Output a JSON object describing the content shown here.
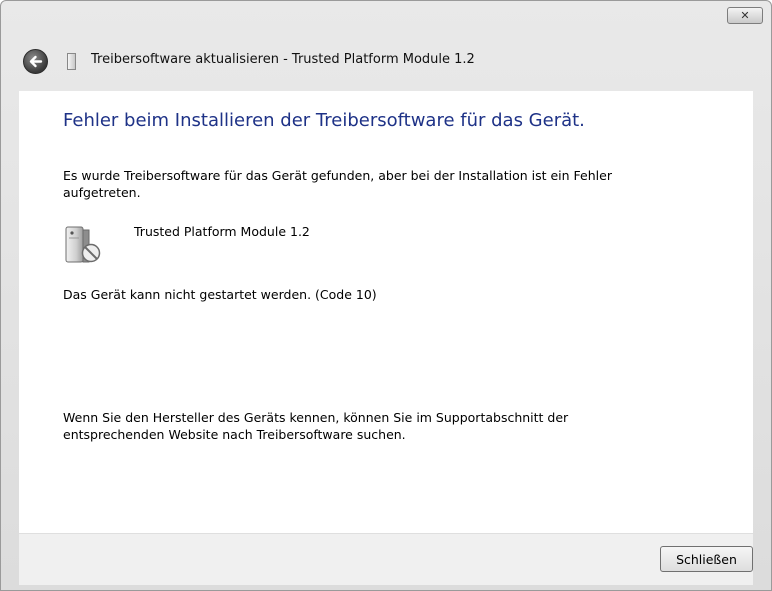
{
  "window": {
    "title": "Treibersoftware aktualisieren - Trusted Platform Module 1.2",
    "close_glyph": "✕"
  },
  "content": {
    "heading": "Fehler beim Installieren der Treibersoftware für das Gerät.",
    "message1": "Es wurde Treibersoftware für das Gerät gefunden, aber bei der Installation ist ein Fehler aufgetreten.",
    "device_name": "Trusted Platform Module 1.2",
    "message2": "Das Gerät kann nicht gestartet werden. (Code 10)",
    "message3": "Wenn Sie den Hersteller des Geräts kennen, können Sie im Supportabschnitt der entsprechenden Website nach Treibersoftware suchen."
  },
  "footer": {
    "close_button_label": "Schließen"
  },
  "colors": {
    "heading": "#1e3287",
    "footer_bg": "#f0f0f0",
    "chrome_bg": "#e2e2e2"
  }
}
